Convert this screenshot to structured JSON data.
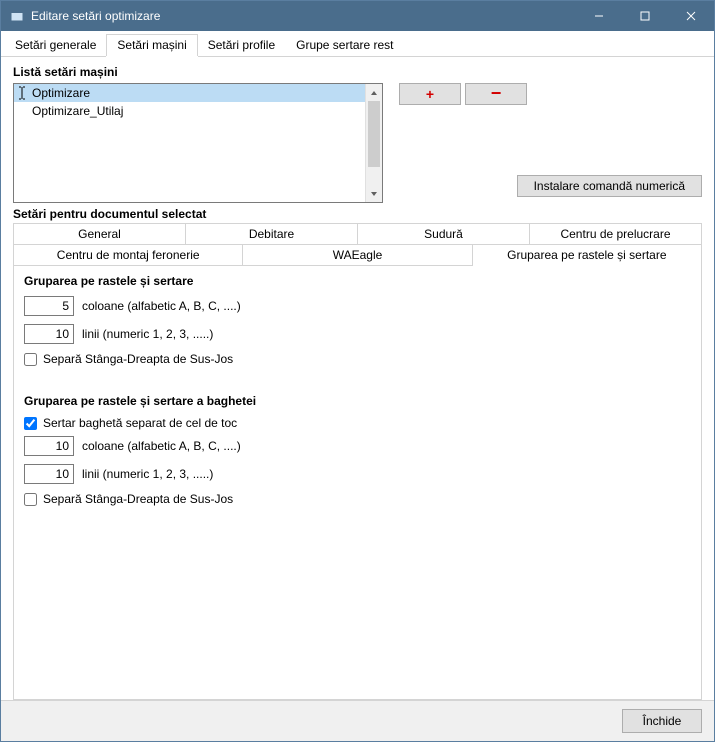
{
  "window": {
    "title": "Editare setări optimizare"
  },
  "outer_tabs": [
    "Setări generale",
    "Setări mașini",
    "Setări profile",
    "Grupe sertare rest"
  ],
  "outer_tabs_active": 1,
  "list_label": "Listă setări mașini",
  "list_items": [
    "Optimizare",
    "Optimizare_Utilaj"
  ],
  "list_selected": 0,
  "buttons": {
    "plus": "+",
    "minus": "−",
    "install": "Instalare comandă numerică",
    "close": "Închide"
  },
  "doc_label": "Setări pentru documentul selectat",
  "inner_tabs_row1": [
    "General",
    "Debitare",
    "Sudură",
    "Centru de prelucrare"
  ],
  "inner_tabs_row2": [
    "Centru de montaj feronerie",
    "WAEagle",
    "Gruparea pe rastele și sertare"
  ],
  "inner_tabs_active": "Gruparea pe rastele și sertare",
  "group1": {
    "title": "Gruparea pe rastele și sertare",
    "cols_value": "5",
    "cols_label": "coloane (alfabetic A, B, C, ....)",
    "rows_value": "10",
    "rows_label": "linii (numeric 1, 2, 3, .....)",
    "separate_label": "Separă Stânga-Dreapta de Sus-Jos",
    "separate_checked": false
  },
  "group2": {
    "title": "Gruparea pe rastele și sertare a baghetei",
    "drawer_label": "Sertar baghetă separat de cel de toc",
    "drawer_checked": true,
    "cols_value": "10",
    "cols_label": "coloane (alfabetic A, B, C, ....)",
    "rows_value": "10",
    "rows_label": "linii (numeric 1, 2, 3, .....)",
    "separate_label": "Separă Stânga-Dreapta de Sus-Jos",
    "separate_checked": false
  }
}
